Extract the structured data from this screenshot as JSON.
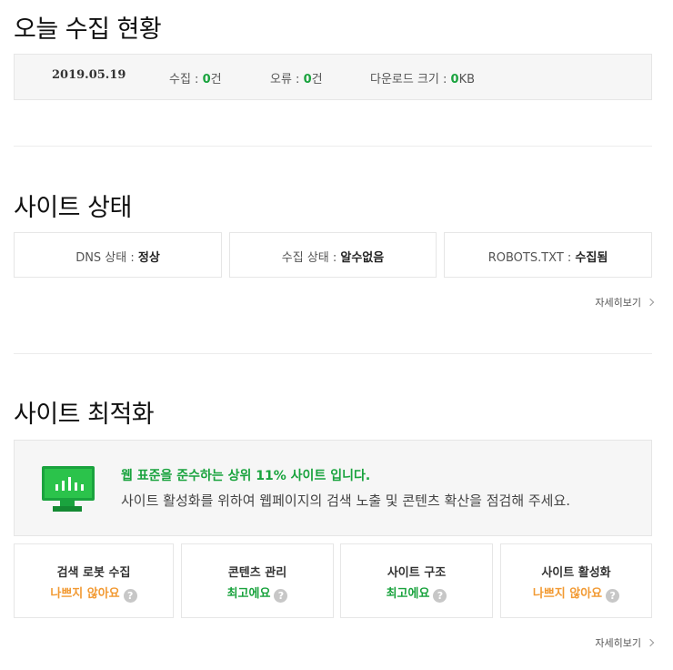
{
  "today": {
    "title": "오늘 수집 현황",
    "date": "2019.05.19",
    "collect_label": "수집 : ",
    "collect_value": "0",
    "collect_unit": "건",
    "error_label": "오류 : ",
    "error_value": "0",
    "error_unit": "건",
    "download_label": "다운로드 크기 : ",
    "download_value": "0",
    "download_unit": "KB"
  },
  "site_status": {
    "title": "사이트 상태",
    "items": [
      {
        "label": "DNS 상태 : ",
        "value": "정상"
      },
      {
        "label": "수집 상태 : ",
        "value": "알수없음"
      },
      {
        "label": "ROBOTS.TXT : ",
        "value": "수집됨"
      }
    ],
    "more_label": "자세히보기"
  },
  "optimization": {
    "title": "사이트 최적화",
    "headline": "웹 표준을 준수하는 상위 11% 사이트 입니다.",
    "description": "사이트 활성화를 위하여 웹페이지의 검색 노출 및 콘텐츠 확산을 점검해 주세요.",
    "cards": [
      {
        "title": "검색 로봇 수집",
        "value": "나쁘지 않아요",
        "tone": "orange"
      },
      {
        "title": "콘텐츠 관리",
        "value": "최고에요",
        "tone": "green"
      },
      {
        "title": "사이트 구조",
        "value": "최고에요",
        "tone": "green"
      },
      {
        "title": "사이트 활성화",
        "value": "나쁘지 않아요",
        "tone": "orange"
      }
    ],
    "help_glyph": "?",
    "more_label": "자세히보기"
  },
  "colors": {
    "accent_green": "#1aa33e",
    "accent_orange": "#f29a33",
    "panel_bg": "#f6f6f6"
  }
}
